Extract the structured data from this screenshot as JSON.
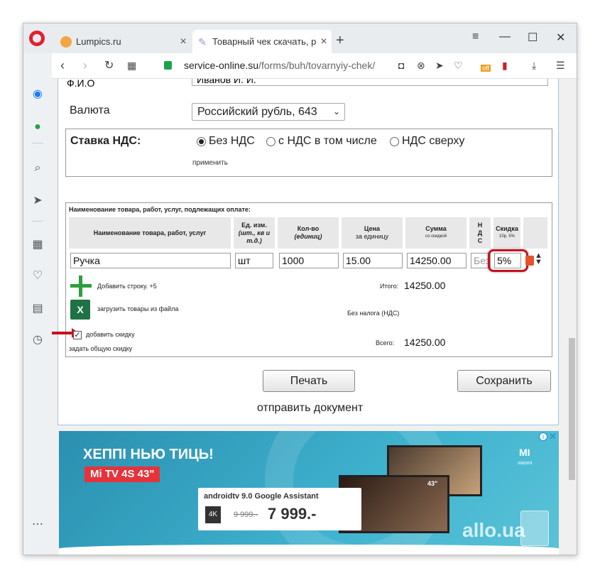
{
  "browser": {
    "tabs": [
      {
        "label": "Lumpics.ru",
        "close": "×"
      },
      {
        "label": "Товарный чек скачать, ра",
        "close": "×"
      }
    ],
    "new_tab": "+",
    "window_controls": {
      "menu": "≡",
      "minimize": "—",
      "maximize": "☐",
      "close": "✕"
    },
    "url_host": "service-online.su",
    "url_path": "/forms/buh/tovarnyiy-chek/",
    "extension_badge": "off"
  },
  "form": {
    "fio_label": "Ф.И.О",
    "fio_value": "Иванов И. И.",
    "valuta_label": "Валюта",
    "valuta_value": "Российский рубль, 643",
    "nds": {
      "title": "Ставка НДС:",
      "options": [
        "Без НДС",
        "с НДС в том числе",
        "НДС сверху"
      ],
      "selected": "Без НДС",
      "apply": "применить"
    },
    "goods": {
      "caption": "Наименование товара, работ, услуг, подлежащих оплате:",
      "headers": {
        "name": "Наименование товара, работ, услуг",
        "unit": "Ед. изм.",
        "unit_sub": "(шт., кв и т.д.)",
        "qty": "Кол-во",
        "qty_sub": "(единиц)",
        "price": "Цена",
        "price_sub": "за единицу",
        "sum": "Сумма",
        "sum_sub": "со скидкой",
        "nds": "НДС",
        "discount": "Скидка",
        "discount_sub": "10р, 5%"
      },
      "row": {
        "name": "Ручка",
        "unit": "шт",
        "qty": "1000",
        "price": "15.00",
        "sum": "14250.00",
        "nds": "Без",
        "discount": "5%"
      },
      "add_row": "Добавить строку. +5",
      "load_file": "загрузить товары из файла",
      "add_discount": "добавить скидку",
      "general_discount": "задать общую скидку",
      "itogo_label": "Итого:",
      "itogo_value": "14250.00",
      "bez_naloga": "Без налога (НДС)",
      "vsego_label": "Всего:",
      "vsego_value": "14250.00"
    },
    "print_label": "Печать",
    "save_label": "Сохранить",
    "send_label": "отправить документ"
  },
  "ad": {
    "title": "ХЕППІ НЬЮ ТИЦЬ!",
    "badge": "Mi TV 4S 43\"",
    "android": "androidtv 9.0 Google Assistant",
    "hdr": "4K",
    "old_price": "9 999.-",
    "new_price": "7 999.-",
    "size": "43\"",
    "mi": "MI",
    "xiaomi": "xiaomi",
    "allo": "allo.ua"
  }
}
